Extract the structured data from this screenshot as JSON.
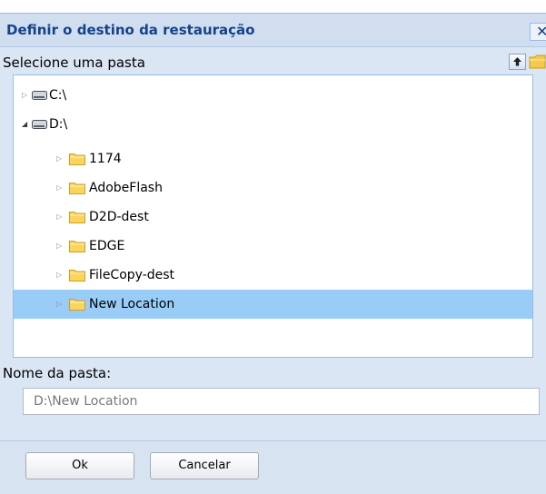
{
  "dialog": {
    "title": "Definir o destino da restauração",
    "close_glyph": "✕",
    "select_label": "Selecione uma pasta",
    "up_icon": "up-arrow-icon",
    "new_folder_icon": "new-folder-icon"
  },
  "tree": {
    "nodes": [
      {
        "label": "C:\\",
        "type": "drive",
        "expanded": false
      },
      {
        "label": "D:\\",
        "type": "drive",
        "expanded": true
      },
      {
        "label": "1174",
        "type": "folder",
        "expanded": false
      },
      {
        "label": "AdobeFlash",
        "type": "folder",
        "expanded": false
      },
      {
        "label": "D2D-dest",
        "type": "folder",
        "expanded": false
      },
      {
        "label": "EDGE",
        "type": "folder",
        "expanded": false
      },
      {
        "label": "FileCopy-dest",
        "type": "folder",
        "expanded": false
      },
      {
        "label": "New Location",
        "type": "folder",
        "expanded": false,
        "selected": true
      }
    ]
  },
  "folder_name": {
    "label": "Nome da pasta:",
    "value": "D:\\New Location"
  },
  "buttons": {
    "ok": "Ok",
    "cancel": "Cancelar"
  },
  "colors": {
    "title_text": "#15428b",
    "panel_bg": "#dbe6f4",
    "selection": "#99cdf8",
    "folder": "#f7c948"
  }
}
